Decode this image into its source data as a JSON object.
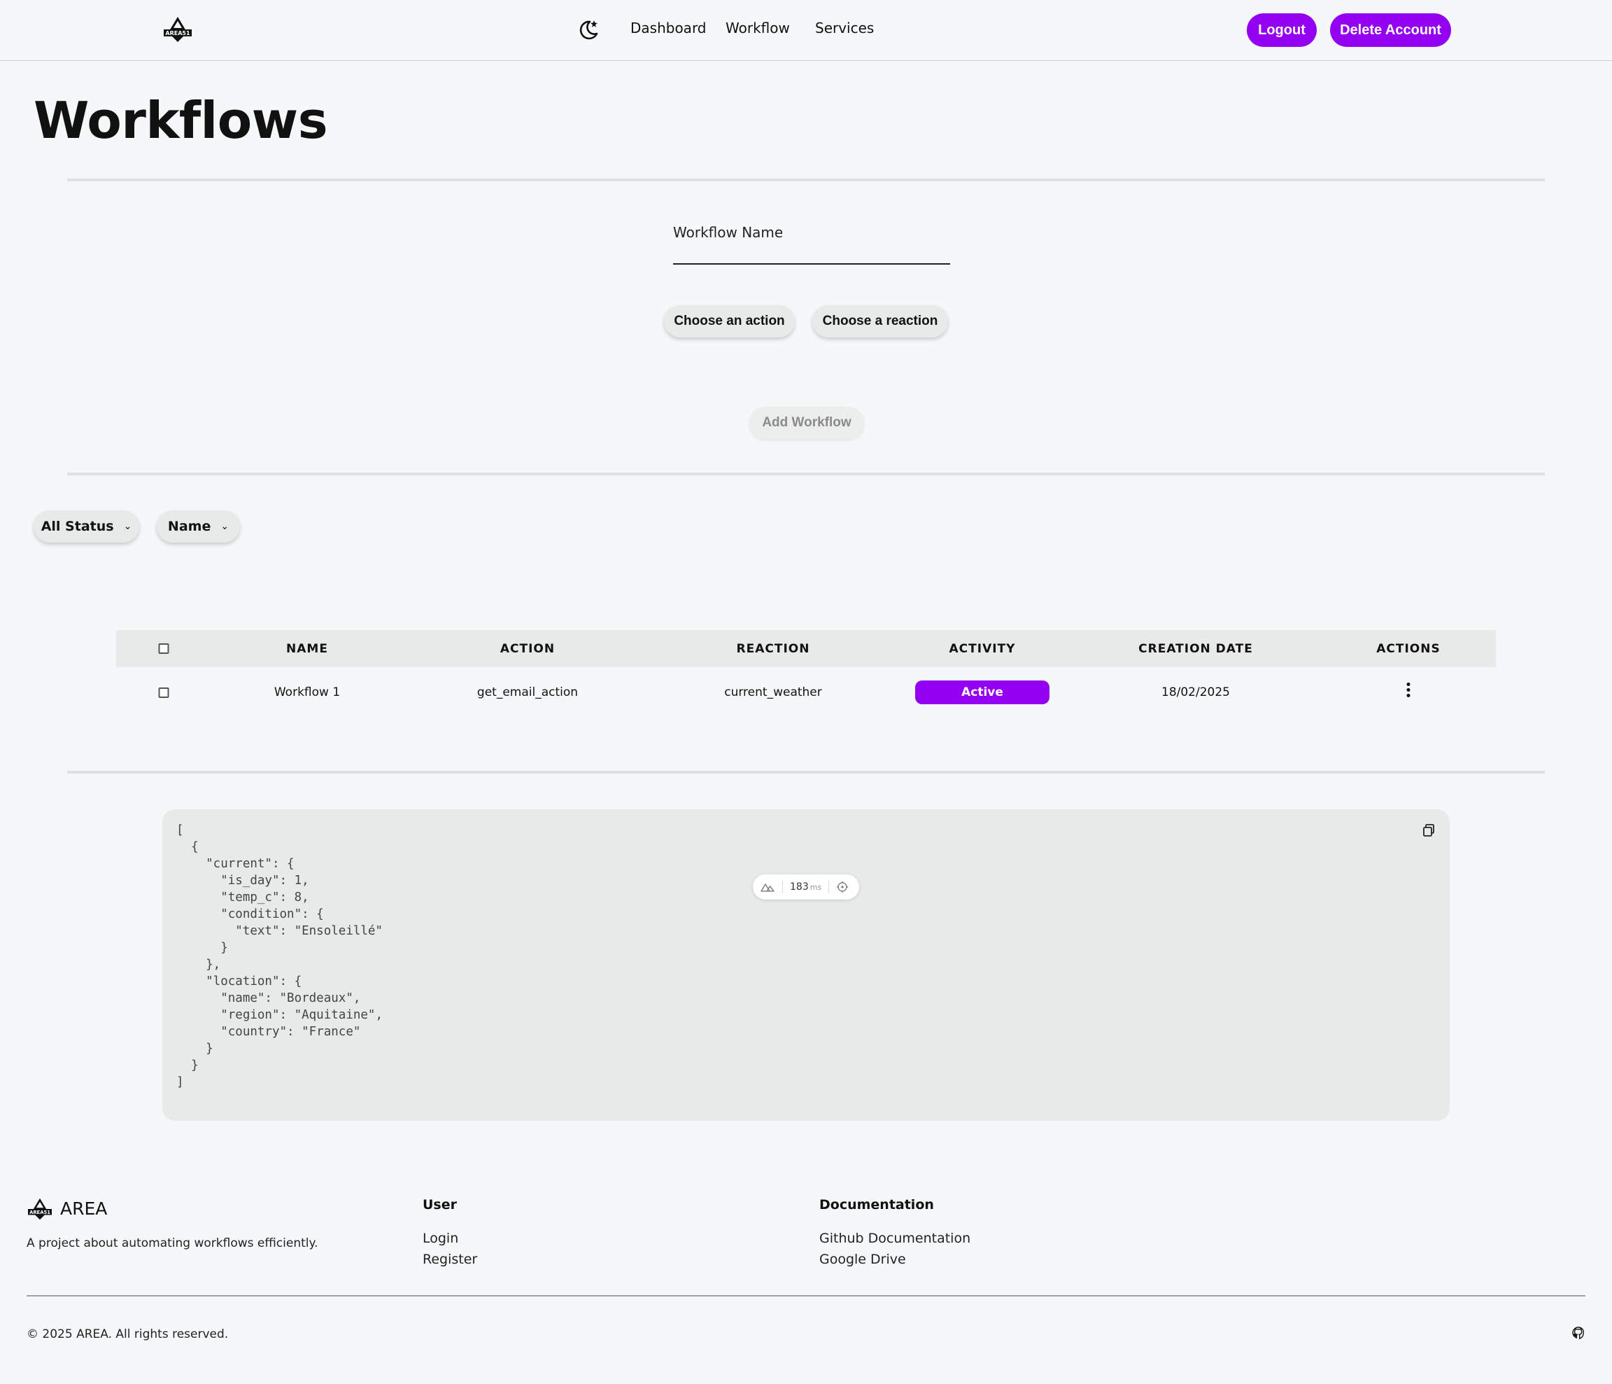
{
  "nav": {
    "links": [
      "Dashboard",
      "Workflow",
      "Services"
    ],
    "logout_label": "Logout",
    "delete_label": "Delete Account",
    "accent_color": "#9400f2"
  },
  "page": {
    "title": "Workflows"
  },
  "form": {
    "name_label": "Workflow Name",
    "name_value": "",
    "choose_action_label": "Choose an action",
    "choose_reaction_label": "Choose a reaction",
    "add_label": "Add Workflow"
  },
  "filters": {
    "status_label": "All Status",
    "sort_label": "Name"
  },
  "table": {
    "headers": [
      "NAME",
      "ACTION",
      "REACTION",
      "ACTIVITY",
      "CREATION DATE",
      "ACTIONS"
    ],
    "rows": [
      {
        "name": "Workflow 1",
        "action": "get_email_action",
        "reaction": "current_weather",
        "activity": "Active",
        "created": "18/02/2025"
      }
    ]
  },
  "code": {
    "content": "[\n  {\n    \"current\": {\n      \"is_day\": 1,\n      \"temp_c\": 8,\n      \"condition\": {\n        \"text\": \"Ensoleillé\"\n      }\n    },\n    \"location\": {\n      \"name\": \"Bordeaux\",\n      \"region\": \"Aquitaine\",\n      \"country\": \"France\"\n    }\n  }\n]"
  },
  "perf": {
    "value": "183",
    "unit": "ms"
  },
  "footer": {
    "brand": "AREA",
    "tagline": "A project about automating workflows efficiently.",
    "user_heading": "User",
    "user_links": [
      "Login",
      "Register"
    ],
    "docs_heading": "Documentation",
    "docs_links": [
      "Github Documentation",
      "Google Drive"
    ],
    "copyright": "© 2025 AREA. All rights reserved."
  },
  "icons": [
    "area-logo-icon",
    "moon-icon",
    "chevron-down-icon",
    "kebab-menu-icon",
    "copy-icon",
    "github-icon"
  ]
}
